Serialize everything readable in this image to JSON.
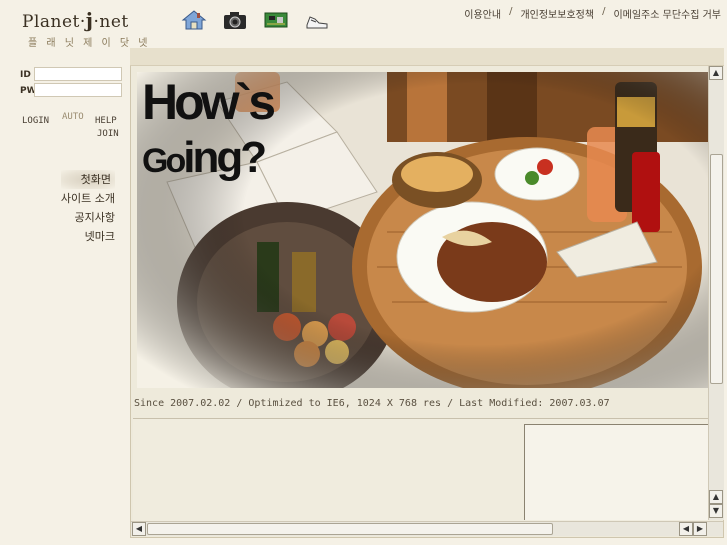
{
  "logo": {
    "text_a": "Planet·",
    "text_j": "j",
    "text_b": "·net",
    "subtitle": "플 래 닛 제 이 닷 넷"
  },
  "top_icons": [
    "home-icon",
    "camera-icon",
    "circuit-board-icon",
    "sneakers-icon"
  ],
  "topnav": {
    "items": [
      "이용안내",
      "개인정보보호정책",
      "이메일주소 무단수집 거부"
    ],
    "separator": "/"
  },
  "login": {
    "id_label": "ID",
    "pw_label": "PW",
    "login": "LOGIN",
    "auto": "AUTO",
    "help": "HELP",
    "join": "JOIN"
  },
  "menu": [
    "첫화면",
    "사이트 소개",
    "공지사항",
    "넷마크"
  ],
  "hero": {
    "line1": "How`s",
    "line2a": "Go",
    "line2b": "ing?"
  },
  "footer": {
    "since": "Since 2007.02.02 / Optimized to IE6, 1024 X 768 res / Last Modified: 2007.03.07"
  },
  "colors": {
    "background": "#f5f1e6",
    "text": "#3a3022"
  }
}
